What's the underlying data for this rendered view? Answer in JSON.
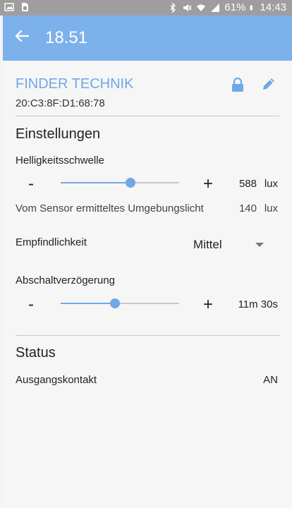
{
  "statusbar": {
    "battery": "61%",
    "time": "14:43",
    "icons": [
      "image-icon",
      "sim-icon",
      "bluetooth-icon",
      "mute-icon",
      "wifi-icon",
      "signal-icon",
      "battery-icon"
    ]
  },
  "appbar": {
    "title": "18.51",
    "back_icon": "back-arrow-icon",
    "color": "#7cb1ec"
  },
  "device": {
    "name": "FINDER TECHNIK",
    "mac": "20:C3:8F:D1:68:78",
    "accent": "#6fa8e6"
  },
  "settings": {
    "title": "Einstellungen",
    "brightness": {
      "label": "Helligkeitsschwelle",
      "minus": "-",
      "plus": "+",
      "value": "588",
      "unit": "lux",
      "level": 0.59
    },
    "ambient": {
      "label": "Vom Sensor ermitteltes Umgebungslicht",
      "value": "140",
      "unit": "lux"
    },
    "sensitivity": {
      "label": "Empfindlichkeit",
      "value": "Mittel"
    },
    "delay": {
      "label": "Abschaltverzögerung",
      "minus": "-",
      "plus": "+",
      "value": "11m 30s",
      "level": 0.46
    }
  },
  "status": {
    "title": "Status",
    "output_label": "Ausgangskontakt",
    "output_value": "AN"
  }
}
